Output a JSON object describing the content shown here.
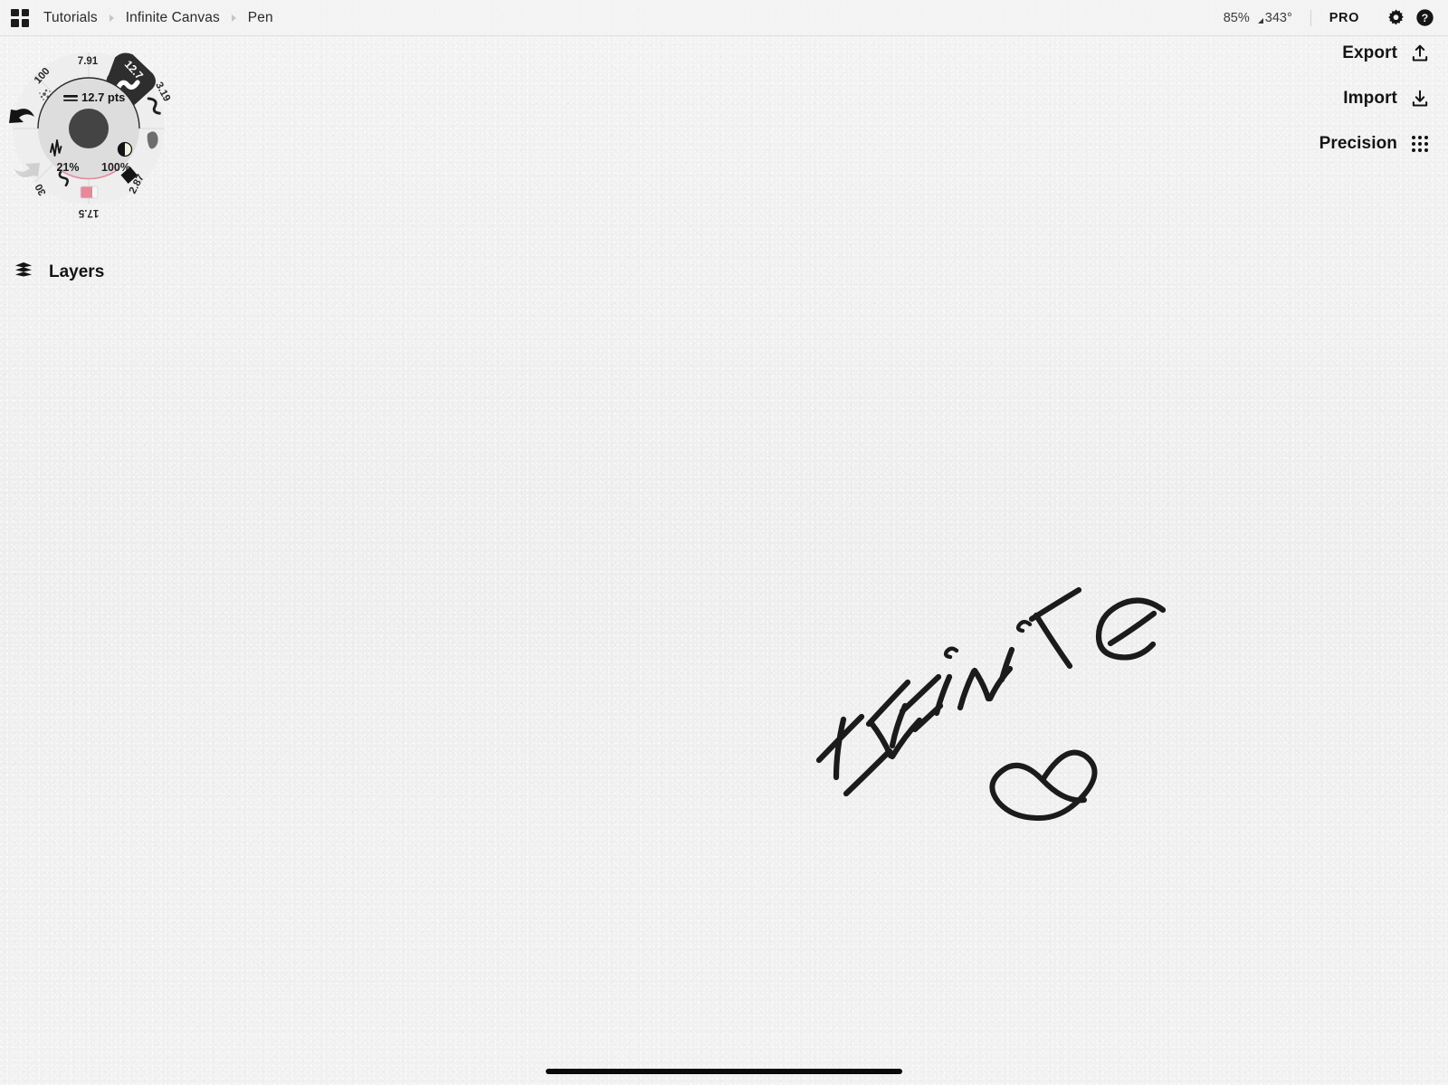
{
  "app": {
    "name": "Infinite Canvas",
    "surface_color": "#f0f0f0",
    "ink_color": "#1a1a1a",
    "accent_color": "#e8899a"
  },
  "topbar": {
    "grid_icon": "app-grid-icon",
    "breadcrumb": [
      {
        "label": "Tutorials"
      },
      {
        "label": "Infinite Canvas"
      },
      {
        "label": "Pen"
      }
    ],
    "zoom_level": "85%",
    "rotation": "343°",
    "pro_badge": "PRO",
    "settings_icon": "gear-icon",
    "help_icon": "question-mark-icon"
  },
  "actions": [
    {
      "label": "Export",
      "icon": "upload-icon"
    },
    {
      "label": "Import",
      "icon": "download-icon"
    },
    {
      "label": "Precision",
      "icon": "dot-grid-icon"
    }
  ],
  "layers": {
    "label": "Layers",
    "icon": "layers-stack-icon"
  },
  "tool_wheel": {
    "center_icon": "center-hub-button",
    "undo_icon": "undo-arrow-icon",
    "redo_icon": "redo-arrow-icon",
    "undo_enabled": "true",
    "redo_enabled": "false",
    "inner": {
      "size_value": "12.7 pts",
      "size_icon": "line-weight-icon",
      "jitter_value": "21%",
      "jitter_icon": "jitter-waveform-icon",
      "opacity_value": "100%",
      "opacity_icon": "opacity-half-circle-icon"
    },
    "segments": [
      {
        "label": "100",
        "icon": "spray-brush-icon",
        "selected": "false"
      },
      {
        "label": "7.91",
        "icon": "texture-brush-icon",
        "selected": "false"
      },
      {
        "label": "12.7",
        "icon": "pen-stroke-icon",
        "selected": "true"
      },
      {
        "label": "3.19",
        "icon": "thin-stroke-icon",
        "selected": "false"
      },
      {
        "label": "",
        "icon": "marker-brush-icon",
        "selected": "false"
      },
      {
        "label": "2.87",
        "icon": "flat-chisel-icon",
        "selected": "false"
      },
      {
        "label": "17.5",
        "icon": "color-swatch-icon",
        "selected": "false"
      },
      {
        "label": "30",
        "icon": "squiggle-brush-icon",
        "selected": "false"
      }
    ]
  },
  "canvas": {
    "drawing_text": "INFINITE",
    "drawing_symbol": "infinity"
  },
  "home_indicator": "home-indicator-bar"
}
